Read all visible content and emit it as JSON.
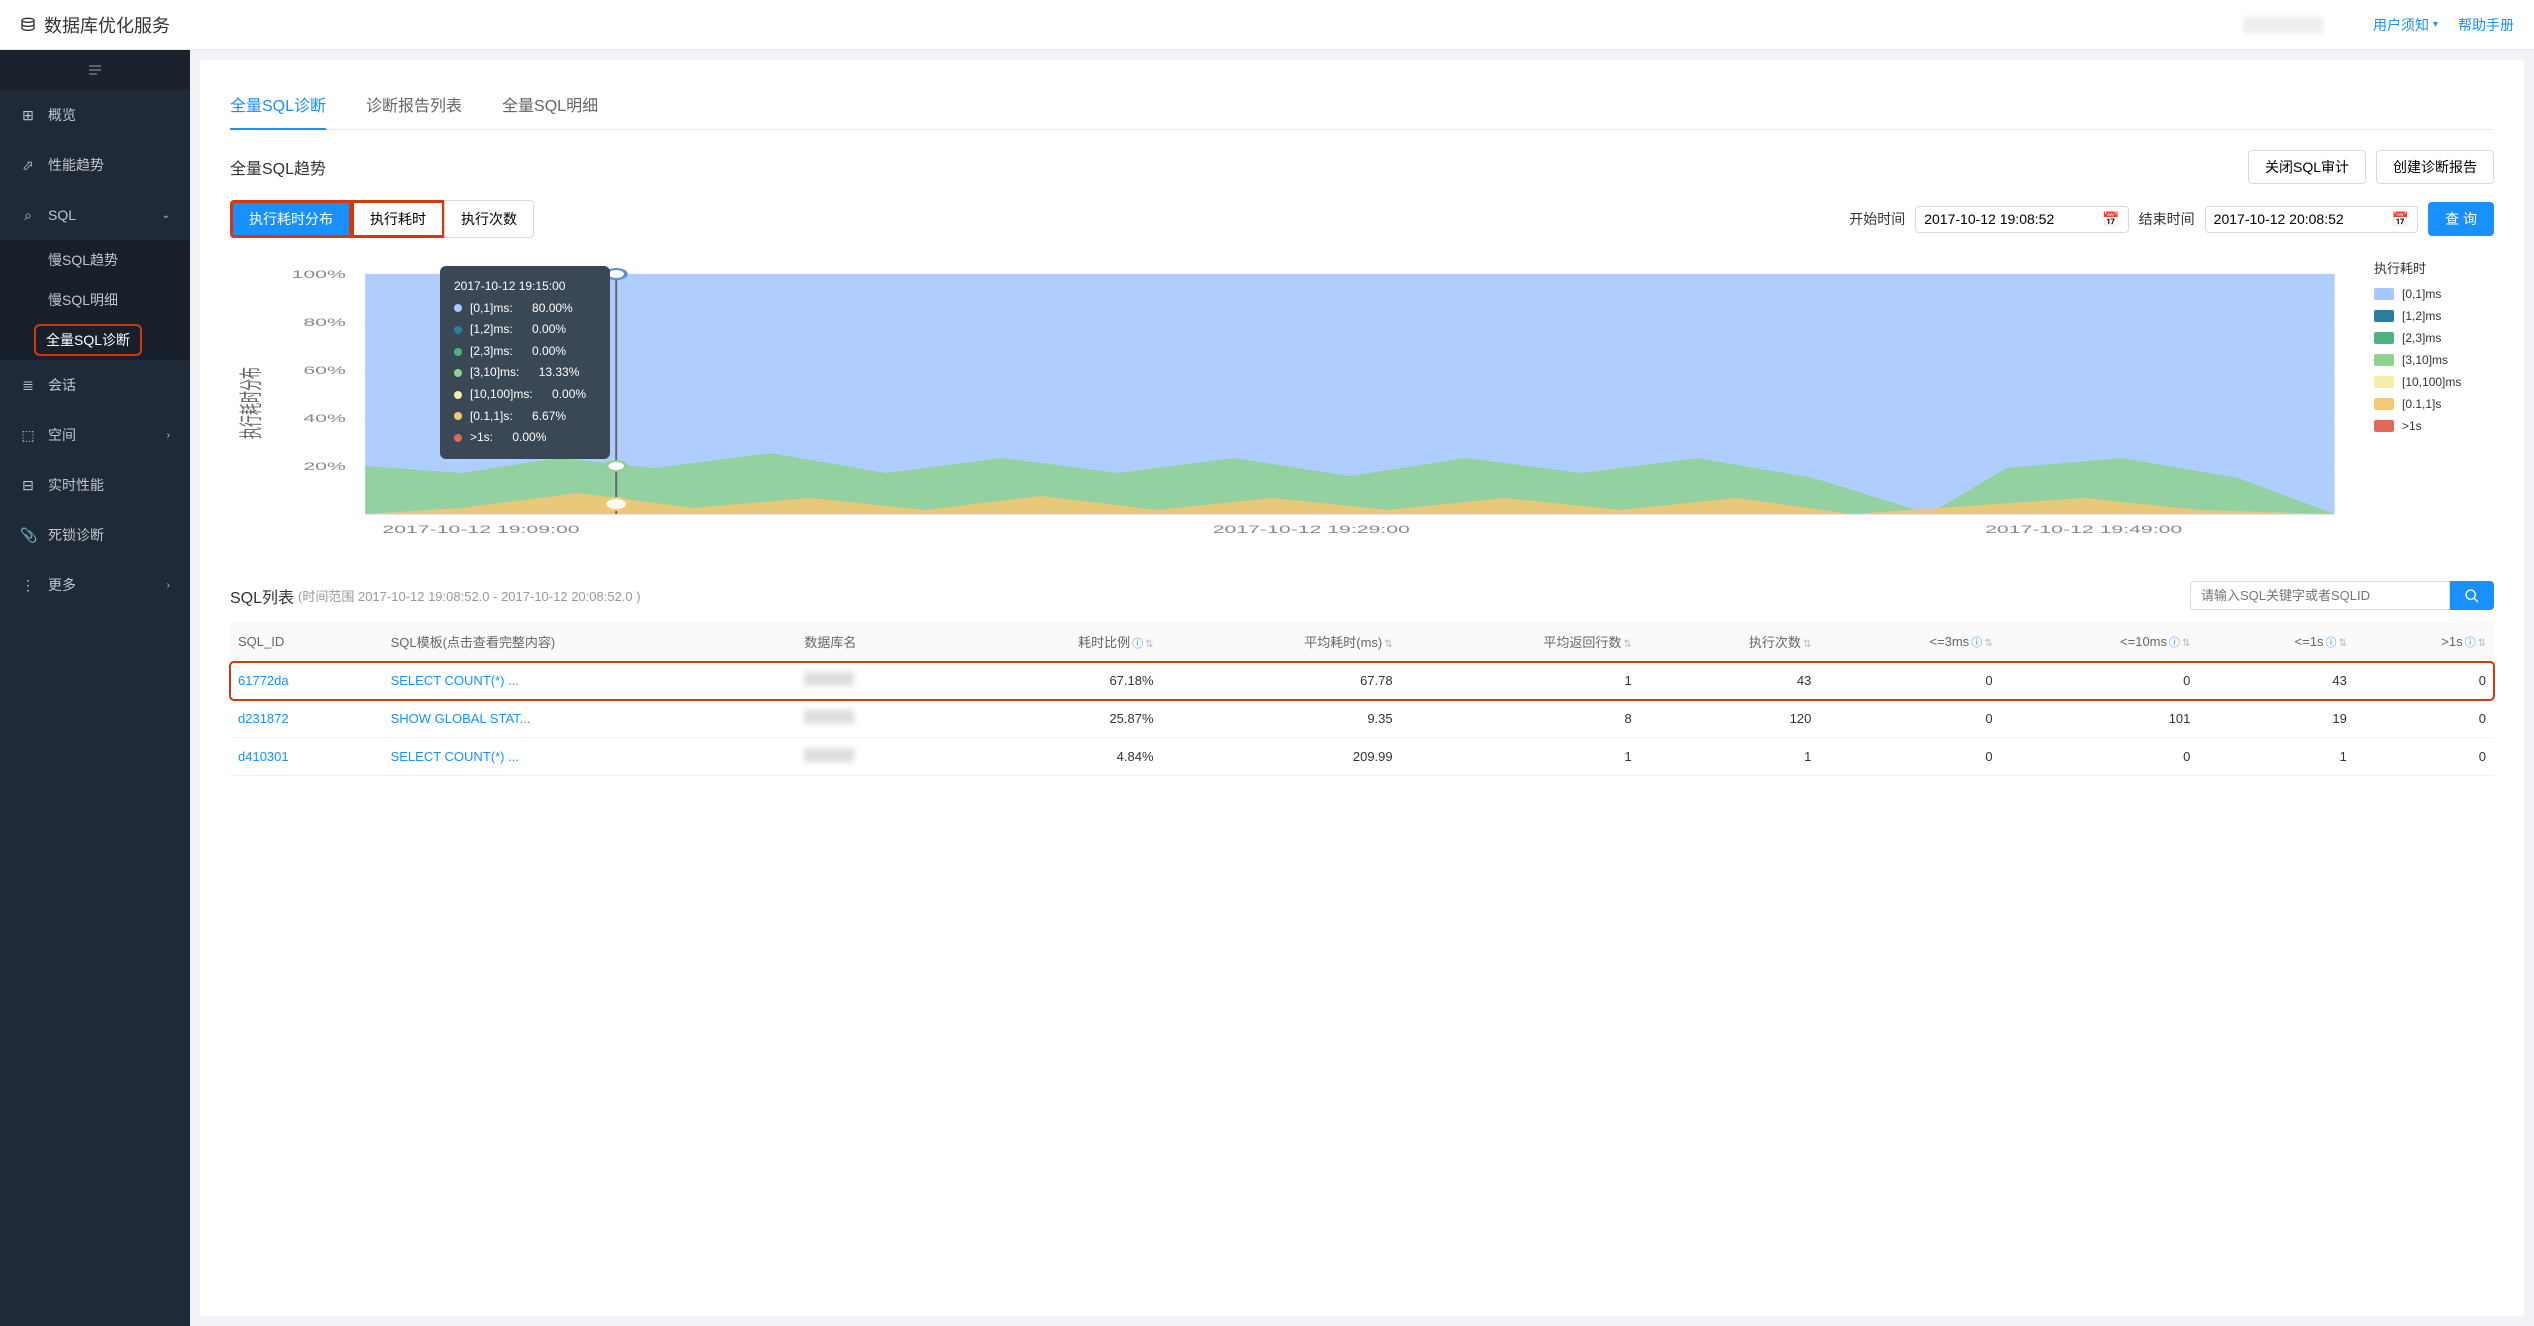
{
  "app": {
    "title": "数据库优化服务"
  },
  "topbar": {
    "user_label": "用户须知",
    "help_label": "帮助手册"
  },
  "sidebar": {
    "items": [
      {
        "label": "概览"
      },
      {
        "label": "性能趋势"
      },
      {
        "label": "SQL",
        "expanded": true
      },
      {
        "label": "会话"
      },
      {
        "label": "空间"
      },
      {
        "label": "实时性能"
      },
      {
        "label": "死锁诊断"
      },
      {
        "label": "更多"
      }
    ],
    "sql_sub": [
      {
        "label": "慢SQL趋势"
      },
      {
        "label": "慢SQL明细"
      },
      {
        "label": "全量SQL诊断",
        "active": true
      }
    ]
  },
  "tabs": [
    {
      "label": "全量SQL诊断",
      "active": true
    },
    {
      "label": "诊断报告列表"
    },
    {
      "label": "全量SQL明细"
    }
  ],
  "trend": {
    "title": "全量SQL趋势",
    "close_audit": "关闭SQL审计",
    "create_report": "创建诊断报告",
    "filter_buttons": [
      "执行耗时分布",
      "执行耗时",
      "执行次数"
    ],
    "start_label": "开始时间",
    "end_label": "结束时间",
    "start_value": "2017-10-12 19:08:52",
    "end_value": "2017-10-12 20:08:52",
    "query_btn": "查 询"
  },
  "chart_data": {
    "type": "area",
    "ylabel": "执行耗时分布",
    "ylim": [
      0,
      100
    ],
    "y_ticks": [
      "20%",
      "40%",
      "60%",
      "80%",
      "100%"
    ],
    "x_ticks": [
      "2017-10-12 19:09:00",
      "2017-10-12 19:29:00",
      "2017-10-12 19:49:00"
    ],
    "legend_title": "执行耗时",
    "series": [
      {
        "name": "[0,1]ms",
        "color": "#a6c8ff"
      },
      {
        "name": "[1,2]ms",
        "color": "#2a7f9e"
      },
      {
        "name": "[2,3]ms",
        "color": "#4fb381"
      },
      {
        "name": "[3,10]ms",
        "color": "#8fd18f"
      },
      {
        "name": "[10,100]ms",
        "color": "#f0f0a8"
      },
      {
        "name": "[0.1,1]s",
        "color": "#f7c873"
      },
      {
        "name": ">1s",
        "color": "#e06a5a"
      }
    ],
    "tooltip": {
      "time": "2017-10-12 19:15:00",
      "rows": [
        {
          "label": "[0,1]ms:",
          "value": "80.00%",
          "color": "#a6c8ff"
        },
        {
          "label": "[1,2]ms:",
          "value": "0.00%",
          "color": "#2a7f9e"
        },
        {
          "label": "[2,3]ms:",
          "value": "0.00%",
          "color": "#4fb381"
        },
        {
          "label": "[3,10]ms:",
          "value": "13.33%",
          "color": "#8fd18f"
        },
        {
          "label": "[10,100]ms:",
          "value": "0.00%",
          "color": "#f0f0a8"
        },
        {
          "label": "[0.1,1]s:",
          "value": "6.67%",
          "color": "#f7c873"
        },
        {
          "label": ">1s:",
          "value": "0.00%",
          "color": "#e06a5a"
        }
      ]
    }
  },
  "sql_list": {
    "title": "SQL列表",
    "subtitle": "(时间范围 2017-10-12 19:08:52.0 - 2017-10-12 20:08:52.0 )",
    "search_placeholder": "请输入SQL关键字或者SQLID",
    "columns": [
      "SQL_ID",
      "SQL模板(点击查看完整内容)",
      "数据库名",
      "耗时比例",
      "平均耗时(ms)",
      "平均返回行数",
      "执行次数",
      "<=3ms",
      "<=10ms",
      "<=1s",
      ">1s"
    ],
    "rows": [
      {
        "id": "61772da",
        "tmpl": "SELECT COUNT(*) ...",
        "ratio": "67.18%",
        "avg_ms": "67.78",
        "avg_rows": "1",
        "exec": "43",
        "le3": "0",
        "le10": "0",
        "le1s": "43",
        "gt1s": "0",
        "highlight": true
      },
      {
        "id": "d231872",
        "tmpl": "SHOW GLOBAL STAT...",
        "ratio": "25.87%",
        "avg_ms": "9.35",
        "avg_rows": "8",
        "exec": "120",
        "le3": "0",
        "le10": "101",
        "le1s": "19",
        "gt1s": "0"
      },
      {
        "id": "d410301",
        "tmpl": "SELECT COUNT(*) ...",
        "ratio": "4.84%",
        "avg_ms": "209.99",
        "avg_rows": "1",
        "exec": "1",
        "le3": "0",
        "le10": "0",
        "le1s": "1",
        "gt1s": "0"
      }
    ]
  }
}
